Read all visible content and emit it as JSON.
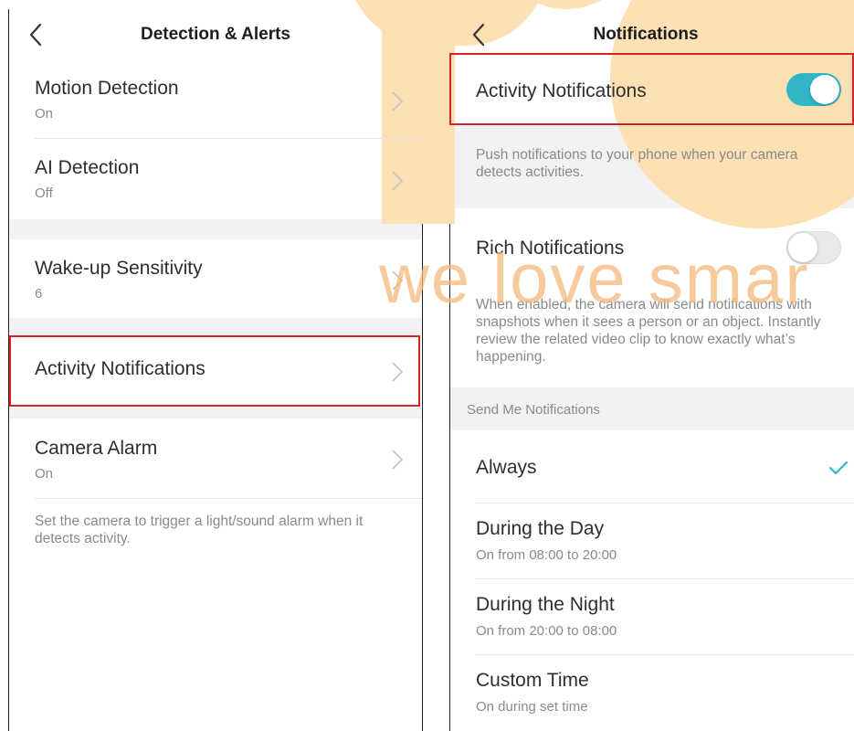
{
  "left": {
    "title": "Detection & Alerts",
    "items": [
      {
        "label": "Motion Detection",
        "value": "On"
      },
      {
        "label": "AI Detection",
        "value": "Off"
      },
      {
        "label": "Wake-up Sensitivity",
        "value": "6"
      },
      {
        "label": "Activity Notifications"
      },
      {
        "label": "Camera Alarm",
        "value": "On"
      }
    ],
    "camera_alarm_note": "Set the camera to trigger a light/sound alarm when it detects activity."
  },
  "right": {
    "title": "Notifications",
    "activity_notifications": {
      "label": "Activity Notifications",
      "enabled": true,
      "description": "Push notifications to your phone when your camera detects activities."
    },
    "rich_notifications": {
      "label": "Rich Notifications",
      "enabled": false,
      "description": "When enabled, the camera will send notifications with snapshots when it sees a person or an object. Instantly review the related video clip to know exactly what’s happening."
    },
    "send_me_header": "Send Me Notifications",
    "schedule_options": [
      {
        "label": "Always",
        "selected": true
      },
      {
        "label": "During the Day",
        "sub": "On from 08:00 to 20:00",
        "selected": false
      },
      {
        "label": "During the Night",
        "sub": "On from 20:00 to 08:00",
        "selected": false
      },
      {
        "label": "Custom Time",
        "sub": "On during set time",
        "selected": false
      }
    ]
  },
  "watermark": "we love smar",
  "colors": {
    "accent_toggle": "#2fb7c6",
    "check": "#2fb7c6",
    "highlight_border": "#d62424",
    "watermark": "#fde0b4"
  },
  "icons": [
    "back-arrow-icon",
    "chevron-right-icon",
    "checkmark-icon"
  ]
}
